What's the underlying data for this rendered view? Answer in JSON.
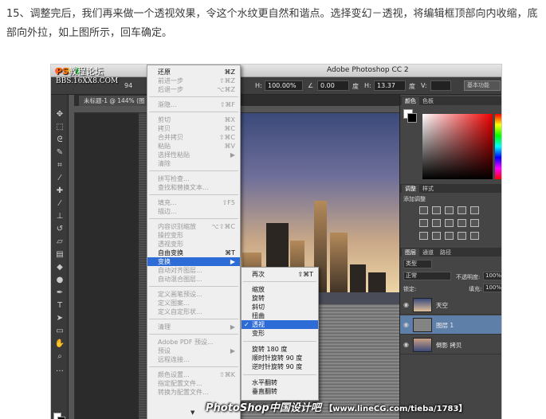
{
  "caption": "15、调整完后，我们再来做一个透视效果，令这个水纹更自然和谐点。选择变幻－透视，将编辑框顶部向内收缩，底部向外拉，如上图所示，回车确定。",
  "watermark": {
    "ps": "PS",
    "forum": "教程论坛",
    "bbs": "BBS.16XX8.COM"
  },
  "window": {
    "title": "Adobe Photoshop CC 2"
  },
  "optionsbar": {
    "num": "94",
    "h_label": "H:",
    "h_value": "100.00%",
    "angle_value": "0.00",
    "deg1": "度",
    "h2_label": "H:",
    "h2_value": "13.37",
    "deg2": "度",
    "v_label": "V:",
    "workspace": "基本功能"
  },
  "document_tab": "未标题-1 @ 144% (图",
  "edit_menu": {
    "items": [
      {
        "label": "还原",
        "shortcut": "⌘Z",
        "disabled": false
      },
      {
        "label": "前进一步",
        "shortcut": "⇧⌘Z",
        "disabled": true
      },
      {
        "label": "后退一步",
        "shortcut": "⌥⌘Z",
        "disabled": true
      },
      {
        "label": "渐隐...",
        "shortcut": "⇧⌘F",
        "disabled": true
      },
      {
        "label": "剪切",
        "shortcut": "⌘X",
        "disabled": true
      },
      {
        "label": "拷贝",
        "shortcut": "⌘C",
        "disabled": true
      },
      {
        "label": "合并拷贝",
        "shortcut": "⇧⌘C",
        "disabled": true
      },
      {
        "label": "粘贴",
        "shortcut": "⌘V",
        "disabled": true
      },
      {
        "label": "选择性粘贴",
        "shortcut": "▶",
        "disabled": true
      },
      {
        "label": "清除",
        "shortcut": "",
        "disabled": true
      },
      {
        "label": "拼写检查...",
        "shortcut": "",
        "disabled": true
      },
      {
        "label": "查找和替换文本...",
        "shortcut": "",
        "disabled": true
      },
      {
        "label": "填充...",
        "shortcut": "⇧F5",
        "disabled": true
      },
      {
        "label": "描边...",
        "shortcut": "",
        "disabled": true
      },
      {
        "label": "内容识别缩放",
        "shortcut": "⌥⇧⌘C",
        "disabled": true
      },
      {
        "label": "操控变形",
        "shortcut": "",
        "disabled": true
      },
      {
        "label": "透视变形",
        "shortcut": "",
        "disabled": true
      },
      {
        "label": "自由变换",
        "shortcut": "⌘T",
        "disabled": false
      },
      {
        "label": "变换",
        "shortcut": "▶",
        "disabled": false,
        "selected": true
      },
      {
        "label": "自动对齐图层...",
        "shortcut": "",
        "disabled": true
      },
      {
        "label": "自动混合图层...",
        "shortcut": "",
        "disabled": true
      },
      {
        "label": "定义画笔预设...",
        "shortcut": "",
        "disabled": true
      },
      {
        "label": "定义图案...",
        "shortcut": "",
        "disabled": true
      },
      {
        "label": "定义自定形状...",
        "shortcut": "",
        "disabled": true
      },
      {
        "label": "清理",
        "shortcut": "▶",
        "disabled": true
      },
      {
        "label": "Adobe PDF 预设...",
        "shortcut": "",
        "disabled": true
      },
      {
        "label": "预设",
        "shortcut": "▶",
        "disabled": true
      },
      {
        "label": "远程连接...",
        "shortcut": "",
        "disabled": true
      },
      {
        "label": "颜色设置...",
        "shortcut": "⇧⌘K",
        "disabled": true
      },
      {
        "label": "指定配置文件...",
        "shortcut": "",
        "disabled": true
      },
      {
        "label": "转换为配置文件...",
        "shortcut": "",
        "disabled": true
      }
    ]
  },
  "transform_submenu": {
    "items": [
      {
        "label": "再次",
        "shortcut": "⇧⌘T"
      },
      {
        "label": "缩放",
        "shortcut": ""
      },
      {
        "label": "旋转",
        "shortcut": ""
      },
      {
        "label": "斜切",
        "shortcut": ""
      },
      {
        "label": "扭曲",
        "shortcut": ""
      },
      {
        "label": "透视",
        "shortcut": "",
        "selected": true,
        "checked": true
      },
      {
        "label": "变形",
        "shortcut": ""
      },
      {
        "label": "旋转 180 度",
        "shortcut": ""
      },
      {
        "label": "顺时针旋转 90 度",
        "shortcut": ""
      },
      {
        "label": "逆时针旋转 90 度",
        "shortcut": ""
      },
      {
        "label": "水平翻转",
        "shortcut": ""
      },
      {
        "label": "垂直翻转",
        "shortcut": ""
      }
    ]
  },
  "panels": {
    "color_tabs": [
      "颜色",
      "色板"
    ],
    "adjust_tabs": [
      "调整",
      "样式"
    ],
    "adjust_title": "添加调整",
    "layer_tabs": [
      "图层",
      "通道",
      "路径"
    ],
    "kind_label": "类型",
    "blend_mode": "正常",
    "opacity_label": "不透明度:",
    "opacity_value": "100%",
    "lock_label": "锁定:",
    "fill_label": "填充:",
    "fill_value": "100%",
    "layers": [
      {
        "name": "天空",
        "selected": false
      },
      {
        "name": "图层 1",
        "selected": true
      },
      {
        "name": "倒影 拷贝",
        "selected": false
      }
    ]
  },
  "footer_watermark": {
    "brand": "PhotoShop中国设计吧",
    "url": "【www.lineCG.com/tieba/1783】"
  },
  "colors": {
    "menu_highlight": "#2d6bd6",
    "panel_bg": "#454545",
    "layer_selected": "#5d7fa8"
  }
}
